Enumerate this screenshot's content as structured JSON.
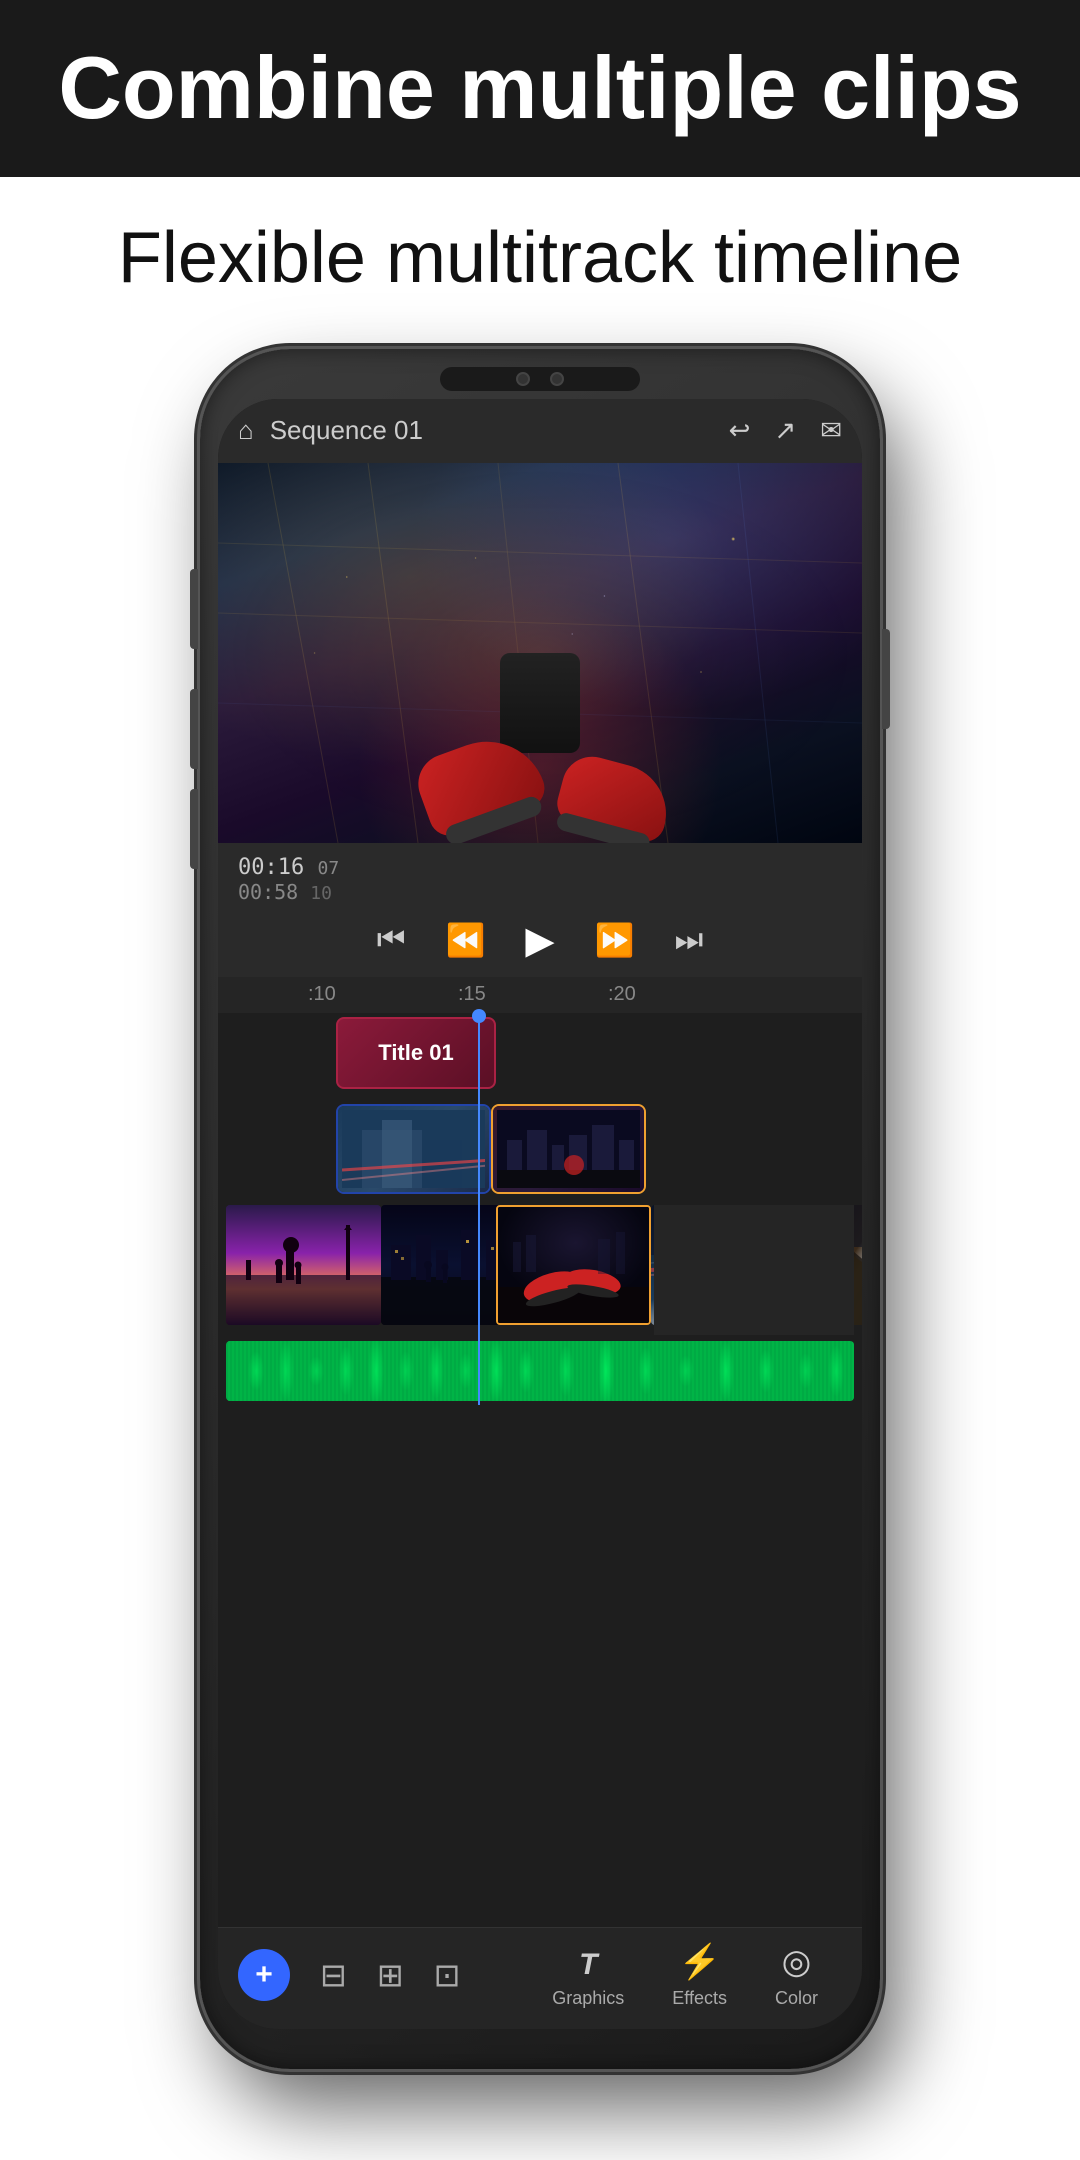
{
  "header": {
    "title": "Combine multiple clips",
    "subtitle": "Flexible multitrack timeline"
  },
  "phone": {
    "topbar": {
      "title": "Sequence 01",
      "home_icon": "🏠",
      "undo_icon": "↩",
      "share_icon": "⎋",
      "chat_icon": "💬"
    },
    "playback": {
      "time_current": "00:16",
      "frame_current": "07",
      "time_total": "00:58",
      "frame_total": "10",
      "ctrl_skip_start": "⏮",
      "ctrl_skip_back": "⏪",
      "ctrl_play": "▶",
      "ctrl_skip_fwd": "⏩",
      "ctrl_skip_end": "⏭"
    },
    "timeline": {
      "ruler": {
        "mark1": ":10",
        "mark2": ":15",
        "mark3": ":20"
      },
      "title_clip": {
        "label": "Title 01"
      },
      "clips": [
        "city_sunset",
        "dock_night",
        "person_air",
        "building",
        "museum"
      ]
    },
    "toolbar": {
      "add_label": "+",
      "tabs": [
        {
          "label": "Graphics",
          "icon": "T",
          "active": false
        },
        {
          "label": "Effects",
          "icon": "⚡",
          "active": false
        },
        {
          "label": "Color",
          "icon": "◎",
          "active": false
        }
      ]
    }
  },
  "colors": {
    "accent_blue": "#3366ff",
    "playhead": "#4488ff",
    "title_clip_bg": "#8b1a3a",
    "audio_track": "#00aa44",
    "selected_clip_border": "#f0a030"
  }
}
